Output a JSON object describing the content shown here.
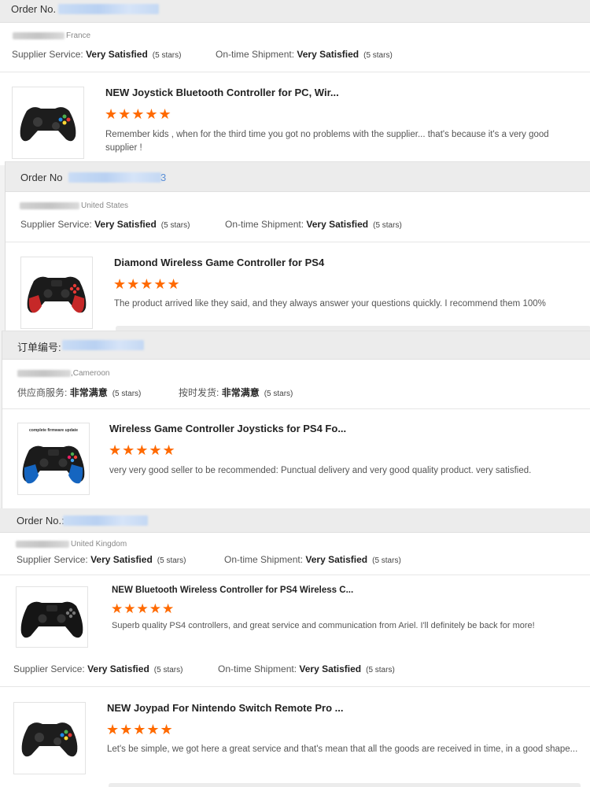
{
  "reviews": [
    {
      "order_label": "Order No.",
      "country": "France",
      "supplier_label": "Supplier Service:",
      "supplier_value": "Very Satisfied",
      "supplier_stars": "(5 stars)",
      "shipment_label": "On-time Shipment:",
      "shipment_value": "Very Satisfied",
      "shipment_stars": "(5 stars)",
      "product_title": "NEW Joystick Bluetooth Controller for PC, Wir...",
      "rating": "★★★★★",
      "review_text": "Remember kids , when for the third time you got no problems with the supplier... that's because it's a very good supplier !"
    },
    {
      "order_label": "Order No",
      "order_suffix": "3",
      "country": "United States",
      "supplier_label": "Supplier Service:",
      "supplier_value": "Very Satisfied",
      "supplier_stars": "(5 stars)",
      "shipment_label": "On-time Shipment:",
      "shipment_value": "Very Satisfied",
      "shipment_stars": "(5 stars)",
      "product_title": "Diamond Wireless Game Controller for PS4",
      "rating": "★★★★★",
      "review_text": "The product arrived like they said, and they always answer your questions quickly. I recommend them 100%"
    },
    {
      "order_label": "订单编号:",
      "country": ",Cameroon",
      "supplier_label": "供应商服务:",
      "supplier_value": "非常满意",
      "supplier_stars": "(5 stars)",
      "shipment_label": "按时发货:",
      "shipment_value": "非常满意",
      "shipment_stars": "(5 stars)",
      "product_title": "Wireless Game Controller Joysticks for PS4 Fo...",
      "thumb_caption": "complete firmware update",
      "rating": "★★★★★",
      "review_text": "very very good seller to be recommended: Punctual delivery and very good quality product. very satisfied."
    },
    {
      "order_label": "Order No.:",
      "country": "United Kingdom",
      "supplier_label": "Supplier Service:",
      "supplier_value": "Very Satisfied",
      "supplier_stars": "(5 stars)",
      "shipment_label": "On-time Shipment:",
      "shipment_value": "Very Satisfied",
      "shipment_stars": "(5 stars)",
      "product_title": "NEW Bluetooth Wireless Controller for PS4 Wireless C...",
      "rating": "★★★★★",
      "review_text": "Superb quality PS4 controllers, and great service and communication from Ariel.  I'll definitely be back for more!"
    },
    {
      "supplier_label": "Supplier Service:",
      "supplier_value": "Very Satisfied",
      "supplier_stars": "(5 stars)",
      "shipment_label": "On-time Shipment:",
      "shipment_value": "Very Satisfied",
      "shipment_stars": "(5 stars)",
      "product_title": "NEW Joypad For Nintendo Switch Remote Pro ...",
      "rating": "★★★★★",
      "review_text": "Let's be simple, we got here a great service and that's mean that all the goods are received in time, in a good shape..."
    }
  ],
  "colors": {
    "star": "#ff6a00",
    "order_bar": "#ececec",
    "blurred_id": "#c9dcf5"
  },
  "icons": [
    "black-gamepad-icon",
    "red-ps4-controller-icon",
    "blue-ps4-controller-icon",
    "black-ps4-controller-icon",
    "black-gamepad-icon"
  ]
}
